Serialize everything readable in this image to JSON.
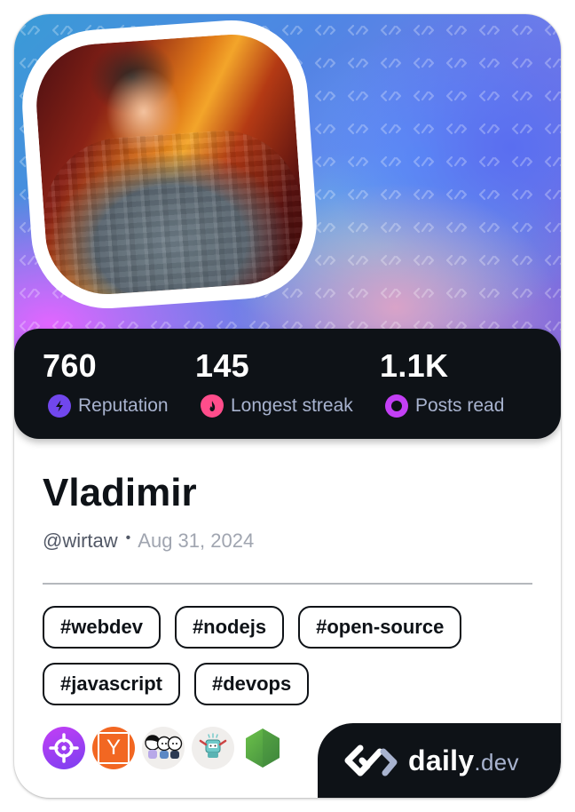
{
  "profile": {
    "name": "Vladimir",
    "handle": "@wirtaw",
    "separator": "•",
    "joined": "Aug 31, 2024",
    "avatar_alt": "Profile photo of a man in a grey cable-knit sweater covering his face with his hand"
  },
  "stats": [
    {
      "value": "760",
      "label": "Reputation",
      "icon": "lightning-icon",
      "color": "#7147ed"
    },
    {
      "value": "145",
      "label": "Longest streak",
      "icon": "flame-icon",
      "color": "#ff4d8b"
    },
    {
      "value": "1.1K",
      "label": "Posts read",
      "icon": "eye-ring-icon",
      "color": "#c33ff5"
    }
  ],
  "tags": [
    "#webdev",
    "#nodejs",
    "#open-source",
    "#javascript",
    "#devops"
  ],
  "badges": [
    {
      "name": "crosshair-target-badge",
      "letter": ""
    },
    {
      "name": "ycombinator-badge",
      "letter": "Y"
    },
    {
      "name": "cartoon-friends-badge",
      "letter": ""
    },
    {
      "name": "robot-badge",
      "letter": ""
    },
    {
      "name": "nodejs-badge",
      "letter": ""
    }
  ],
  "brand": {
    "word": "daily",
    "tld": ".dev"
  },
  "colors": {
    "dark": "#0e1217",
    "label": "#a8b3cf",
    "reputation": "#7147ed",
    "streak": "#ff4d8b",
    "posts": "#c33ff5"
  }
}
